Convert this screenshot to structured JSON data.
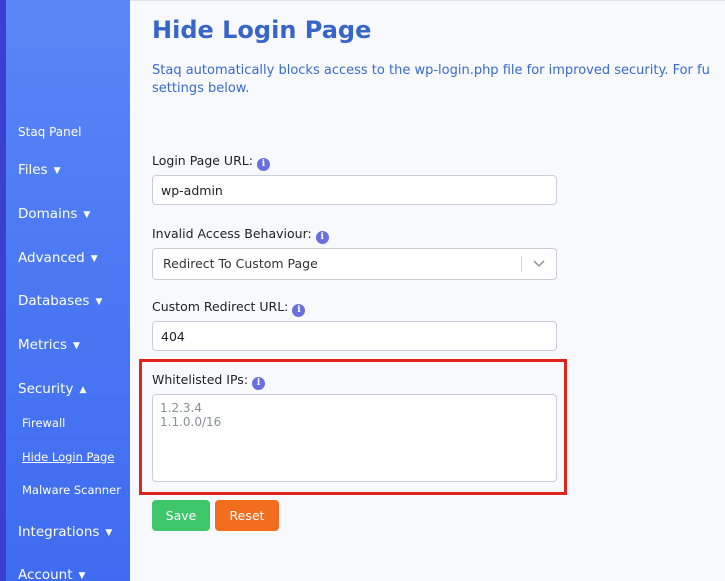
{
  "sidebar": {
    "panel_label": "Staq Panel",
    "items": [
      {
        "label": "Files",
        "caret": "▼"
      },
      {
        "label": "Domains",
        "caret": "▼"
      },
      {
        "label": "Advanced",
        "caret": "▼"
      },
      {
        "label": "Databases",
        "caret": "▼"
      },
      {
        "label": "Metrics",
        "caret": "▼"
      },
      {
        "label": "Security",
        "caret": "▲"
      },
      {
        "label": "Integrations",
        "caret": "▼"
      },
      {
        "label": "Account",
        "caret": "▼"
      }
    ],
    "security_sub": [
      {
        "label": "Firewall"
      },
      {
        "label": "Hide Login Page",
        "active": true
      },
      {
        "label": "Malware Scanner"
      }
    ]
  },
  "page": {
    "title": "Hide Login Page",
    "description_line1": "Staq automatically blocks access to the wp-login.php file for improved security. For fu",
    "description_line2": "settings below."
  },
  "form": {
    "login_url_label": "Login Page URL:",
    "login_url_value": "wp-admin",
    "behaviour_label": "Invalid Access Behaviour:",
    "behaviour_value": "Redirect To Custom Page",
    "redirect_label": "Custom Redirect URL:",
    "redirect_value": "404",
    "whitelist_label": "Whitelisted IPs:",
    "whitelist_placeholder": "1.2.3.4\n1.1.0.0/16",
    "info_glyph": "i",
    "save_label": "Save",
    "reset_label": "Reset"
  },
  "colors": {
    "accent": "#3866c8",
    "sidebar": "#4a78f3",
    "save": "#3ec66a",
    "reset": "#f36d1e",
    "highlight": "#e0231b"
  }
}
